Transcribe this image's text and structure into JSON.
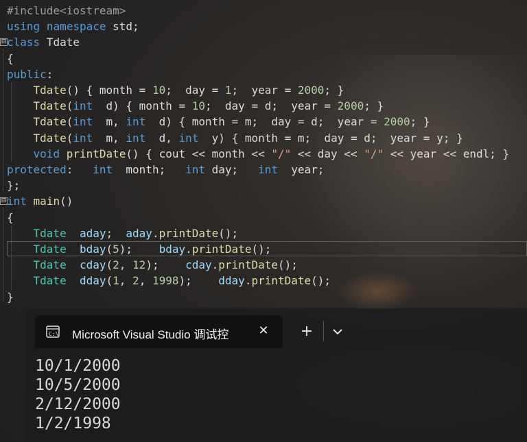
{
  "editor": {
    "code": [
      [
        {
          "t": "#include<iostream>",
          "c": "pp"
        }
      ],
      [
        {
          "t": "using",
          "c": "kw"
        },
        {
          "t": " ",
          "c": "plain"
        },
        {
          "t": "namespace",
          "c": "kw"
        },
        {
          "t": " std;",
          "c": "plain"
        }
      ],
      [
        {
          "t": "class",
          "c": "kw"
        },
        {
          "t": " ",
          "c": "plain"
        },
        {
          "t": "Tdate",
          "c": "plain"
        }
      ],
      [
        {
          "t": "{",
          "c": "plain"
        }
      ],
      [
        {
          "t": "public",
          "c": "kw"
        },
        {
          "t": ":",
          "c": "plain"
        }
      ],
      [
        {
          "t": "    ",
          "c": "plain"
        },
        {
          "t": "Tdate",
          "c": "fn"
        },
        {
          "t": "() { month = ",
          "c": "plain"
        },
        {
          "t": "10",
          "c": "num"
        },
        {
          "t": ";  day = ",
          "c": "plain"
        },
        {
          "t": "1",
          "c": "num"
        },
        {
          "t": ";  year = ",
          "c": "plain"
        },
        {
          "t": "2000",
          "c": "num"
        },
        {
          "t": "; }",
          "c": "plain"
        }
      ],
      [
        {
          "t": "    ",
          "c": "plain"
        },
        {
          "t": "Tdate",
          "c": "fn"
        },
        {
          "t": "(",
          "c": "plain"
        },
        {
          "t": "int",
          "c": "kw"
        },
        {
          "t": "  d) { month = ",
          "c": "plain"
        },
        {
          "t": "10",
          "c": "num"
        },
        {
          "t": ";  day = d;  year = ",
          "c": "plain"
        },
        {
          "t": "2000",
          "c": "num"
        },
        {
          "t": "; }",
          "c": "plain"
        }
      ],
      [
        {
          "t": "    ",
          "c": "plain"
        },
        {
          "t": "Tdate",
          "c": "fn"
        },
        {
          "t": "(",
          "c": "plain"
        },
        {
          "t": "int",
          "c": "kw"
        },
        {
          "t": "  m, ",
          "c": "plain"
        },
        {
          "t": "int",
          "c": "kw"
        },
        {
          "t": "  d) { month = m;  day = d;  year = ",
          "c": "plain"
        },
        {
          "t": "2000",
          "c": "num"
        },
        {
          "t": "; }",
          "c": "plain"
        }
      ],
      [
        {
          "t": "    ",
          "c": "plain"
        },
        {
          "t": "Tdate",
          "c": "fn"
        },
        {
          "t": "(",
          "c": "plain"
        },
        {
          "t": "int",
          "c": "kw"
        },
        {
          "t": "  m, ",
          "c": "plain"
        },
        {
          "t": "int",
          "c": "kw"
        },
        {
          "t": "  d, ",
          "c": "plain"
        },
        {
          "t": "int",
          "c": "kw"
        },
        {
          "t": "  y) { month = m;  day = d;  year = y; }",
          "c": "plain"
        }
      ],
      [
        {
          "t": "    ",
          "c": "plain"
        },
        {
          "t": "void",
          "c": "kw"
        },
        {
          "t": " ",
          "c": "plain"
        },
        {
          "t": "printDate",
          "c": "fn"
        },
        {
          "t": "() { cout << month << ",
          "c": "plain"
        },
        {
          "t": "\"/\"",
          "c": "str"
        },
        {
          "t": " << day << ",
          "c": "plain"
        },
        {
          "t": "\"/\"",
          "c": "str"
        },
        {
          "t": " << year << endl; }",
          "c": "plain"
        }
      ],
      [
        {
          "t": "protected",
          "c": "kw"
        },
        {
          "t": ":   ",
          "c": "plain"
        },
        {
          "t": "int",
          "c": "kw"
        },
        {
          "t": "  month;   ",
          "c": "plain"
        },
        {
          "t": "int",
          "c": "kw"
        },
        {
          "t": " day;   ",
          "c": "plain"
        },
        {
          "t": "int",
          "c": "kw"
        },
        {
          "t": "  year;",
          "c": "plain"
        }
      ],
      [
        {
          "t": "};",
          "c": "plain"
        }
      ],
      [
        {
          "t": "int",
          "c": "kw"
        },
        {
          "t": " ",
          "c": "plain"
        },
        {
          "t": "main",
          "c": "fn"
        },
        {
          "t": "()",
          "c": "plain"
        }
      ],
      [
        {
          "t": "{",
          "c": "plain"
        }
      ],
      [
        {
          "t": "    ",
          "c": "plain"
        },
        {
          "t": "Tdate",
          "c": "type"
        },
        {
          "t": "  ",
          "c": "plain"
        },
        {
          "t": "aday",
          "c": "var"
        },
        {
          "t": ";  ",
          "c": "plain"
        },
        {
          "t": "aday",
          "c": "var"
        },
        {
          "t": ".",
          "c": "plain"
        },
        {
          "t": "printDate",
          "c": "fn"
        },
        {
          "t": "();",
          "c": "plain"
        }
      ],
      [
        {
          "t": "    ",
          "c": "plain"
        },
        {
          "t": "Tdate",
          "c": "type"
        },
        {
          "t": "  ",
          "c": "plain"
        },
        {
          "t": "bday",
          "c": "var"
        },
        {
          "t": "(",
          "c": "plain"
        },
        {
          "t": "5",
          "c": "num"
        },
        {
          "t": ");    ",
          "c": "plain"
        },
        {
          "t": "bday",
          "c": "var"
        },
        {
          "t": ".",
          "c": "plain"
        },
        {
          "t": "printDate",
          "c": "fn"
        },
        {
          "t": "();",
          "c": "plain"
        }
      ],
      [
        {
          "t": "    ",
          "c": "plain"
        },
        {
          "t": "Tdate",
          "c": "type"
        },
        {
          "t": "  ",
          "c": "plain"
        },
        {
          "t": "cday",
          "c": "var"
        },
        {
          "t": "(",
          "c": "plain"
        },
        {
          "t": "2",
          "c": "num"
        },
        {
          "t": ", ",
          "c": "plain"
        },
        {
          "t": "12",
          "c": "num"
        },
        {
          "t": ");    ",
          "c": "plain"
        },
        {
          "t": "cday",
          "c": "var"
        },
        {
          "t": ".",
          "c": "plain"
        },
        {
          "t": "printDate",
          "c": "fn"
        },
        {
          "t": "();",
          "c": "plain"
        }
      ],
      [
        {
          "t": "    ",
          "c": "plain"
        },
        {
          "t": "Tdate",
          "c": "type"
        },
        {
          "t": "  ",
          "c": "plain"
        },
        {
          "t": "dday",
          "c": "var"
        },
        {
          "t": "(",
          "c": "plain"
        },
        {
          "t": "1",
          "c": "num"
        },
        {
          "t": ", ",
          "c": "plain"
        },
        {
          "t": "2",
          "c": "num"
        },
        {
          "t": ", ",
          "c": "plain"
        },
        {
          "t": "1998",
          "c": "num"
        },
        {
          "t": ");    ",
          "c": "plain"
        },
        {
          "t": "dday",
          "c": "var"
        },
        {
          "t": ".",
          "c": "plain"
        },
        {
          "t": "printDate",
          "c": "fn"
        },
        {
          "t": "();",
          "c": "plain"
        }
      ],
      [
        {
          "t": "}",
          "c": "plain"
        }
      ]
    ],
    "fold_markers": [
      "⊟",
      "⊟"
    ],
    "current_line": 15
  },
  "terminal": {
    "tab_icon": "terminal-icon",
    "tab_title": "Microsoft Visual Studio 调试控",
    "close_glyph": "✕",
    "new_tab_glyph": "+",
    "dropdown_icon": "chevron-down-icon",
    "output": [
      "10/1/2000",
      "10/5/2000",
      "2/12/2000",
      "1/2/1998"
    ]
  },
  "colors": {
    "keyword": "#569cd6",
    "type": "#4ec9b0",
    "function": "#dcdcaa",
    "number": "#b5cea8",
    "string": "#d69d85",
    "variable": "#9cdcfe"
  }
}
